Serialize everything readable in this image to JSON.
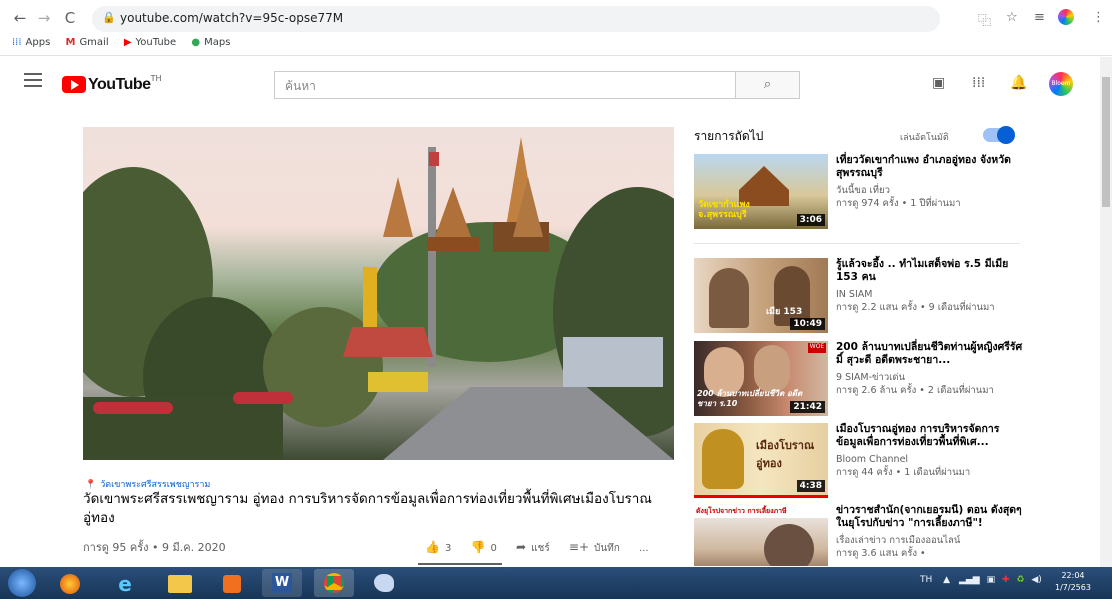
{
  "browser": {
    "url": "youtube.com/watch?v=95c-opse77M",
    "bookmarks": [
      {
        "label": "Apps",
        "icon": "apps-grid-icon"
      },
      {
        "label": "Gmail",
        "icon": "gmail-icon"
      },
      {
        "label": "YouTube",
        "icon": "youtube-icon"
      },
      {
        "label": "Maps",
        "icon": "maps-pin-icon"
      }
    ]
  },
  "youtube": {
    "logo_text": "YouTube",
    "logo_region": "TH",
    "search_placeholder": "ค้นหา",
    "avatar_text": "Bloom"
  },
  "video": {
    "location_tag": "วัดเขาพระศรีสรรเพชญาราม",
    "title": "วัดเขาพระศรีสรรเพชญาราม อู่ทอง การบริหารจัดการข้อมูลเพื่อการท่องเที่ยวพื้นที่พิเศษเมืองโบราณอู่ทอง",
    "views_date": "การดู 95 ครั้ง • 9 มี.ค. 2020",
    "likes": "3",
    "dislikes": "0",
    "share_label": "แชร์",
    "save_label": "บันทึก",
    "more_label": "..."
  },
  "sidebar": {
    "up_next": "รายการถัดไป",
    "autoplay": "เล่นอัตโนมัติ",
    "items": [
      {
        "title": "เที่ยววัดเขากำแพง อำเภออู่ทอง จังหวัดสุพรรณบุรี",
        "channel": "วันนี้ขอ เที่ยว",
        "meta": "การดู 974 ครั้ง • 1 ปีที่ผ่านมา",
        "duration": "3:06",
        "thumb_text": "วัดเขากำแพง จ.สุพรรณบุรี"
      },
      {
        "title": "รู้แล้วจะอึ้ง .. ทำไมเสด็จพ่อ ร.5 มีเมีย 153 คน",
        "channel": "IN SIAM",
        "meta": "การดู 2.2 แสน ครั้ง • 9 เดือนที่ผ่านมา",
        "duration": "10:49",
        "thumb_text": "เมีย 153"
      },
      {
        "title": "200 ล้านบาทเปลี่ยนชีวิตท่านผู้หญิงศรีรัศมิ์ สุวะดี อดีตพระชายา...",
        "channel": "9 SIAM-ข่าวเด่น",
        "meta": "การดู 2.6 ล้าน ครั้ง • 2 เดือนที่ผ่านมา",
        "duration": "21:42",
        "thumb_text": "200 ล้านบาทเปลี่ยนชีวิต อดีตชายา ร.10"
      },
      {
        "title": "เมืองโบราณอู่ทอง การบริหารจัดการข้อมูลเพื่อการท่องเที่ยวพื้นที่พิเศ...",
        "channel": "Bloom Channel",
        "meta": "การดู 44 ครั้ง • 1 เดือนที่ผ่านมา",
        "duration": "4:38",
        "thumb_text": "เมืองโบราณ อู่ทอง"
      },
      {
        "title": "ข่าวราชสำนัก(จากเยอรมนี) ตอน ดังสุดๆในยุโรปกับข่าว \"การเลี้ยงภาษี\"!",
        "channel": "เรื่องเล่าข่าว การเมืองออนไลน์",
        "meta": "การดู 3.6 แสน ครั้ง •",
        "duration": "",
        "thumb_text": "ดังยุโรปจากข่าว การเลี้ยงภาษี"
      }
    ]
  },
  "taskbar": {
    "lang": "TH",
    "time": "22:04",
    "date": "1/7/2563"
  }
}
